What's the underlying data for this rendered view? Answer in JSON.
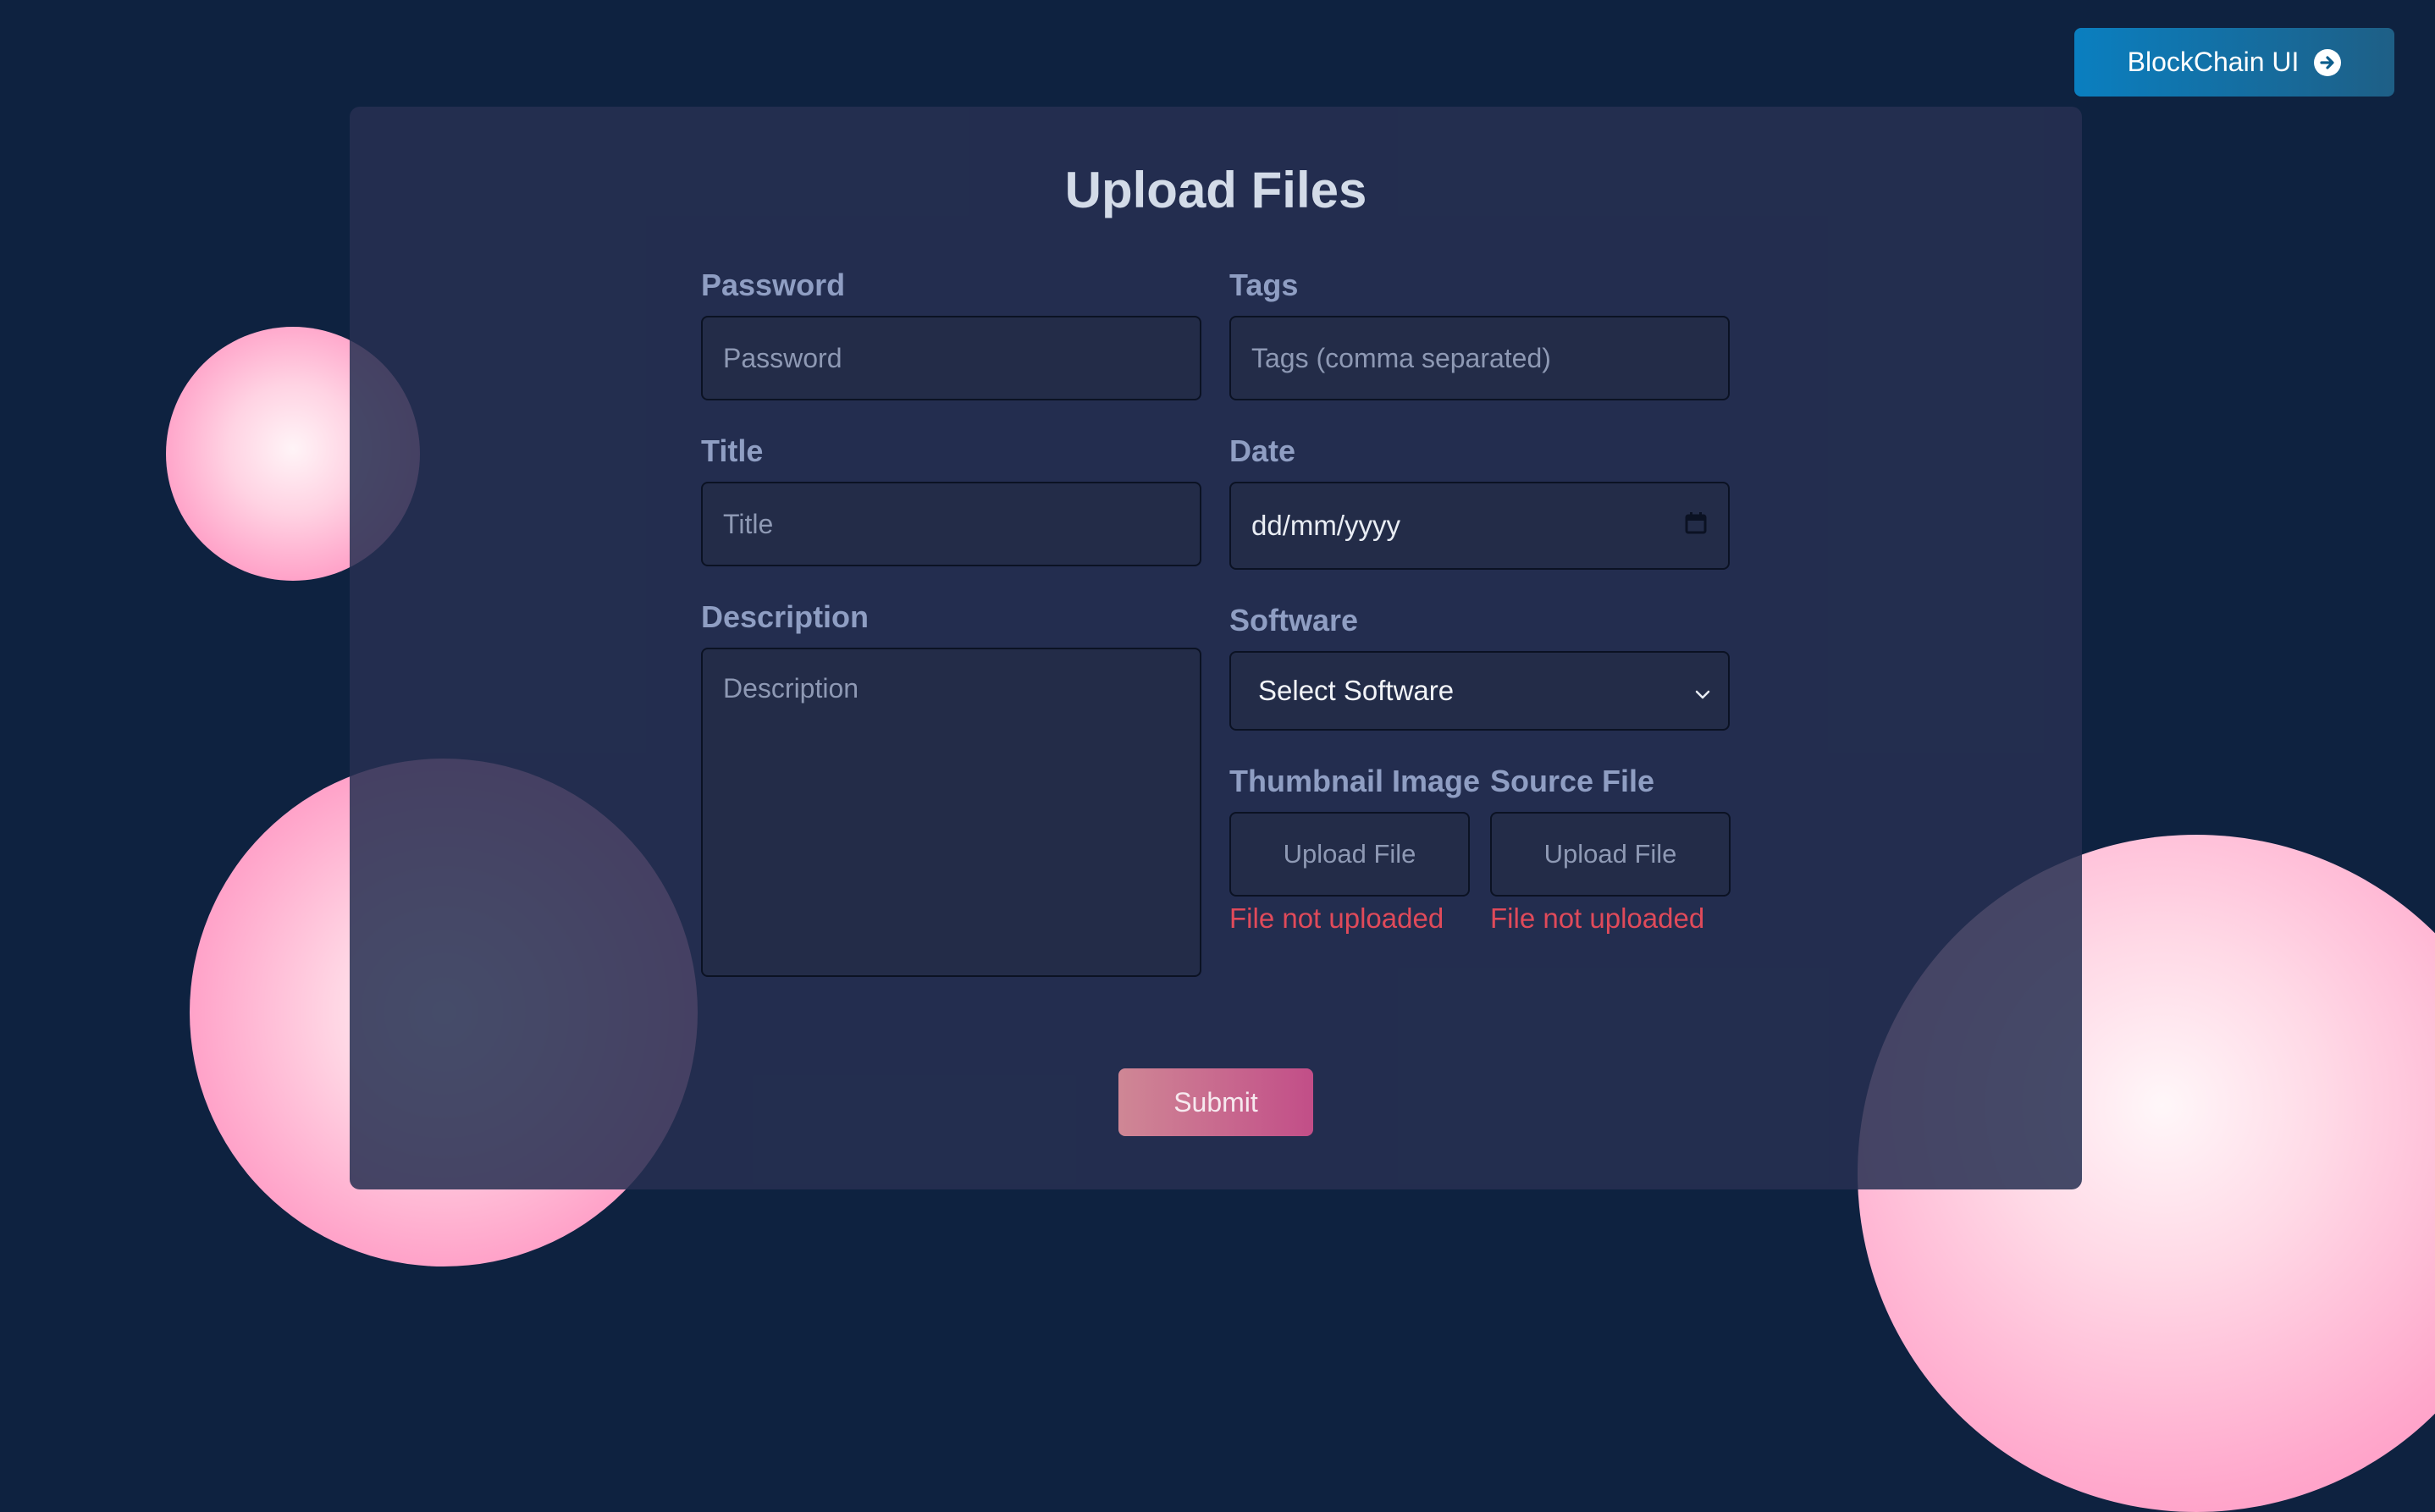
{
  "header": {
    "cta_label": "BlockChain UI",
    "cta_icon": "arrow-right-circle-icon"
  },
  "form": {
    "title": "Upload Files",
    "password": {
      "label": "Password",
      "placeholder": "Password"
    },
    "tags": {
      "label": "Tags",
      "placeholder": "Tags (comma separated)"
    },
    "title_field": {
      "label": "Title",
      "placeholder": "Title"
    },
    "date": {
      "label": "Date",
      "value": "dd/mm/yyyy",
      "icon": "calendar-icon"
    },
    "description": {
      "label": "Description",
      "placeholder": "Description"
    },
    "software": {
      "label": "Software",
      "selected": "Select Software",
      "icon": "chevron-down-icon"
    },
    "thumbnail": {
      "label": "Thumbnail Image",
      "button": "Upload File",
      "status": "File not uploaded"
    },
    "source": {
      "label": "Source File",
      "button": "Upload File",
      "status": "File not uploaded"
    },
    "submit_label": "Submit"
  },
  "colors": {
    "background": "#0e2240",
    "card": "#263052",
    "label": "#8f9ec3",
    "error": "#e04a5a",
    "accent_pink": "#ff8cbc",
    "button_blue": "#0a7fc0"
  }
}
